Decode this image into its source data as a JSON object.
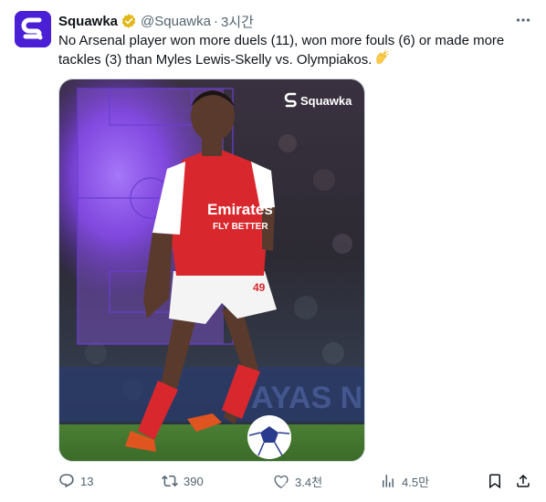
{
  "account": {
    "name": "Squawka",
    "handle": "@Squawka",
    "separator": "·",
    "time": "3시간",
    "avatar_icon": "squawka-logo-icon",
    "brand_color": "#4b1fd6"
  },
  "tweet": {
    "text": "No Arsenal player won more duels (11), won more fouls (6) or made more tackles (3) than Myles Lewis-Skelly vs. Olympiakos.",
    "emoji_icon": "clapping-hands-icon"
  },
  "media": {
    "watermark": "Squawka",
    "shirt_sponsor": "Emirates",
    "shirt_sponsor_sub": "FLY BETTER",
    "shorts_number": "49"
  },
  "actions": {
    "replies": "13",
    "reposts": "390",
    "likes": "3.4천",
    "views": "4.5만"
  },
  "colors": {
    "text": "#0f1419",
    "secondary": "#536471",
    "verified_gold": "#e2b719",
    "arsenal_red": "#d8282d",
    "pitch_purple": "#8a45ff"
  }
}
